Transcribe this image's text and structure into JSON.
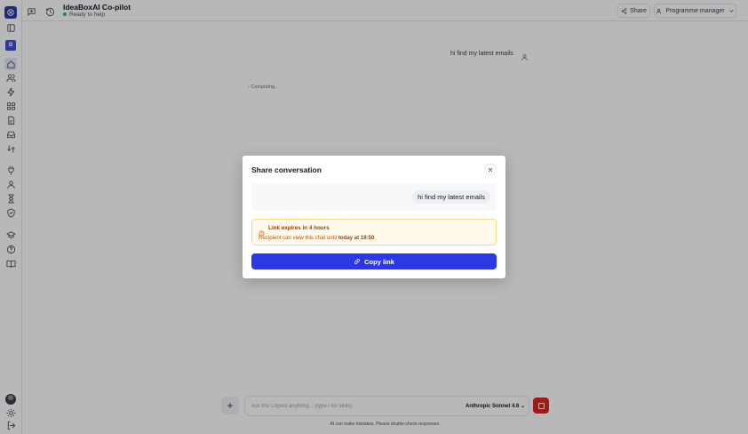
{
  "app": {
    "title": "IdeaBoxAI Co-pilot",
    "status": "Ready to help",
    "workspace_initial": "B"
  },
  "header": {
    "share_label": "Share",
    "role_label": "Programme manager"
  },
  "chat": {
    "user_message": "hi find my latest emails",
    "computing_label": "› Computing..."
  },
  "composer": {
    "placeholder": "Ask the Copilot anything... (type / for skills)",
    "model_label": "Anthropic Sonnet 4.6",
    "disclaimer": "AI can make mistakes. Please double-check responses."
  },
  "modal": {
    "title": "Share conversation",
    "preview_message": "hi find my latest emails",
    "warning_title": "Link expires in 4 hours",
    "warning_text_prefix": "Recipient can view this chat until ",
    "warning_text_time": "today at 19:50",
    "copy_label": "Copy link"
  },
  "colors": {
    "accent": "#2c39e0",
    "stop": "#dc2626",
    "warning_bg": "#fffaeb",
    "status_dot": "#22c55e"
  }
}
